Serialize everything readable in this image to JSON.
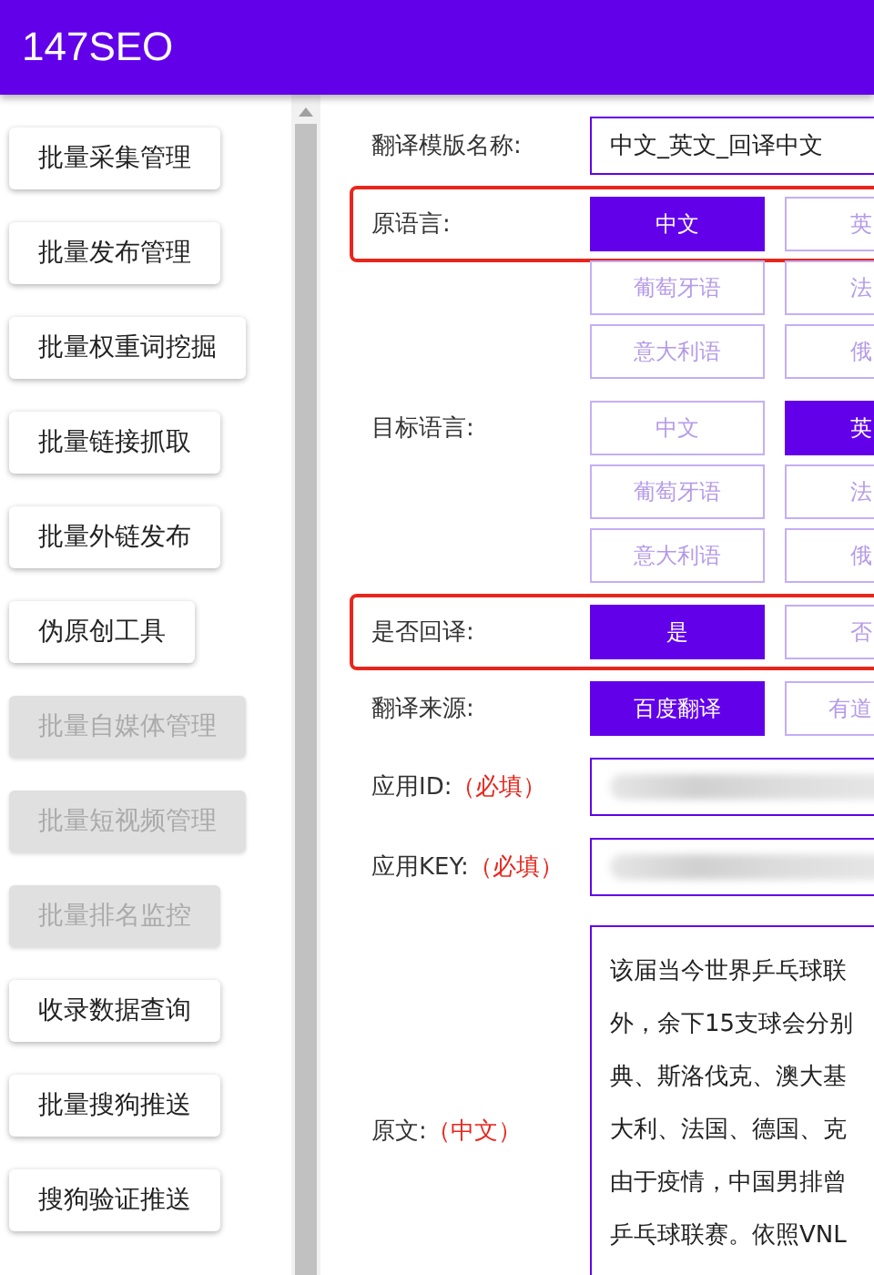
{
  "app": {
    "title": "147SEO"
  },
  "sidebar": {
    "items": [
      {
        "label": "批量采集管理",
        "disabled": false
      },
      {
        "label": "批量发布管理",
        "disabled": false
      },
      {
        "label": "批量权重词挖掘",
        "disabled": false
      },
      {
        "label": "批量链接抓取",
        "disabled": false
      },
      {
        "label": "批量外链发布",
        "disabled": false
      },
      {
        "label": "伪原创工具",
        "disabled": false
      },
      {
        "label": "批量自媒体管理",
        "disabled": true
      },
      {
        "label": "批量短视频管理",
        "disabled": true
      },
      {
        "label": "批量排名监控",
        "disabled": true
      },
      {
        "label": "收录数据查询",
        "disabled": false
      },
      {
        "label": "批量搜狗推送",
        "disabled": false
      },
      {
        "label": "搜狗验证推送",
        "disabled": false
      }
    ]
  },
  "form": {
    "fields": [
      {
        "kind": "text",
        "label": "翻译模版名称:",
        "value": "中文_英文_回译中文"
      },
      {
        "kind": "choice",
        "label": "原语言:",
        "highlighted": true,
        "rows": [
          [
            {
              "label": "中文",
              "selected": true
            },
            {
              "label": "英",
              "selected": false
            }
          ],
          [
            {
              "label": "葡萄牙语",
              "selected": false
            },
            {
              "label": "法",
              "selected": false
            }
          ],
          [
            {
              "label": "意大利语",
              "selected": false
            },
            {
              "label": "俄",
              "selected": false
            }
          ]
        ]
      },
      {
        "kind": "choice",
        "label": "目标语言:",
        "highlighted": false,
        "rows": [
          [
            {
              "label": "中文",
              "selected": false
            },
            {
              "label": "英",
              "selected": true
            }
          ],
          [
            {
              "label": "葡萄牙语",
              "selected": false
            },
            {
              "label": "法",
              "selected": false
            }
          ],
          [
            {
              "label": "意大利语",
              "selected": false
            },
            {
              "label": "俄",
              "selected": false
            }
          ]
        ]
      },
      {
        "kind": "choice",
        "label": "是否回译:",
        "highlighted": true,
        "rows": [
          [
            {
              "label": "是",
              "selected": true
            },
            {
              "label": "否",
              "selected": false
            }
          ]
        ]
      },
      {
        "kind": "choice",
        "label": "翻译来源:",
        "highlighted": false,
        "rows": [
          [
            {
              "label": "百度翻译",
              "selected": true
            },
            {
              "label": "有道",
              "selected": false
            }
          ]
        ]
      },
      {
        "kind": "secret",
        "label": "应用ID:",
        "note": "（必填）"
      },
      {
        "kind": "secret",
        "label": "应用KEY:",
        "note": "（必填）"
      },
      {
        "kind": "textarea",
        "label": "原文:",
        "note": "（中文）",
        "lines": [
          "该届当今世界乒乓球联",
          "外，余下15支球会分别",
          "典、斯洛伐克、澳大基",
          "大利、法国、德国、克",
          "由于疫情，中国男排曾",
          "乒乓球联赛。依照VNL"
        ]
      }
    ]
  }
}
